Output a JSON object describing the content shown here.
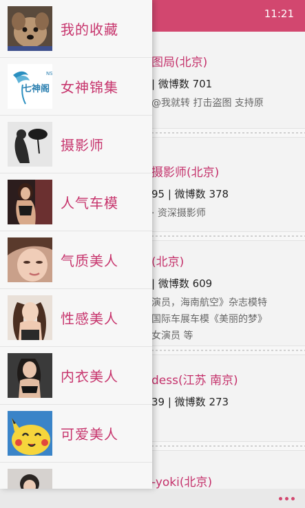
{
  "status_bar": {
    "time": "11:21"
  },
  "drawer": {
    "items": [
      {
        "label": "我的收藏",
        "thumb": "dog-photo-icon"
      },
      {
        "label": "女神锦集",
        "thumb": "goddess-logo-icon"
      },
      {
        "label": "摄影师",
        "thumb": "photographer-photo-icon"
      },
      {
        "label": "人气车模",
        "thumb": "car-model-photo-icon"
      },
      {
        "label": "气质美人",
        "thumb": "elegant-woman-photo-icon"
      },
      {
        "label": "性感美人",
        "thumb": "sexy-woman-photo-icon"
      },
      {
        "label": "内衣美人",
        "thumb": "lingerie-woman-photo-icon"
      },
      {
        "label": "可爱美人",
        "thumb": "pikachu-photo-icon"
      },
      {
        "label": "",
        "thumb": "woman-photo-icon"
      }
    ],
    "goddess_logo_text": "七神阁",
    "goddess_logo_side": "NSG"
  },
  "content": {
    "cards": [
      {
        "title": "图局(北京)",
        "stats": "| 微博数 701",
        "desc": [
          "@我就转  打击盗图  支持原"
        ]
      },
      {
        "title": "摄影师(北京)",
        "stats": "95 | 微博数 378",
        "desc": [
          "· 资深摄影师"
        ]
      },
      {
        "title": "(北京)",
        "stats": "| 微博数 609",
        "desc": [
          "演员，海南航空》杂志模特",
          "国际车展车模《美丽的梦》",
          "女演员 等"
        ]
      },
      {
        "title": "dess(江苏 南京)",
        "stats": "39 | 微博数 273",
        "desc": []
      },
      {
        "title": "-yoki(北京)",
        "stats": "",
        "desc": []
      }
    ]
  },
  "app_bar": {
    "more_label": "更多"
  },
  "colors": {
    "accent": "#d2476f",
    "label": "#c7356d"
  }
}
